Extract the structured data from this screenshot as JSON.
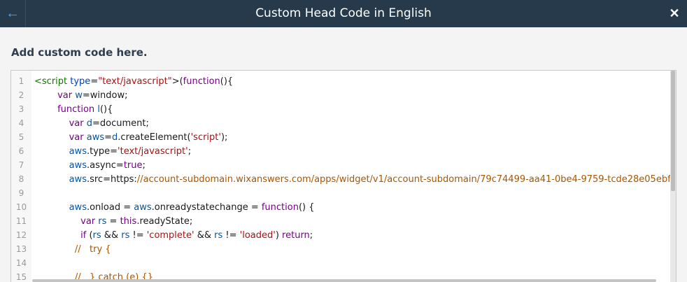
{
  "header": {
    "title": "Custom Head Code in English",
    "back_icon": "←",
    "close_icon": "✕"
  },
  "section": {
    "heading": "Add custom code here."
  },
  "editor": {
    "line_numbers": [
      "1",
      "2",
      "3",
      "4",
      "5",
      "6",
      "7",
      "8",
      "9",
      "10",
      "11",
      "12",
      "13",
      "14",
      "15"
    ],
    "lines": [
      "<script type=\"text/javascript\">(function(){",
      "        var w=window;",
      "        function l(){",
      "            var d=document;",
      "            var aws=d.createElement('script');",
      "            aws.type='text/javascript';",
      "            aws.async=true;",
      "            aws.src='https://account-subdomain.wixanswers.com/apps/widget/v1/account-subdomain/79c74499-aa41-0be4-9759-tcde28e05ebf/en/e",
      "",
      "            aws.onload = aws.onreadystatechange = function() {",
      "                var rs = this.readyState;",
      "                if (rs && rs != 'complete' && rs != 'loaded') return;",
      "              //   try {",
      "",
      "              //   } catch (e) {}"
    ]
  },
  "colors": {
    "header_bg": "#263a4c",
    "accent": "#4a9ff0"
  }
}
